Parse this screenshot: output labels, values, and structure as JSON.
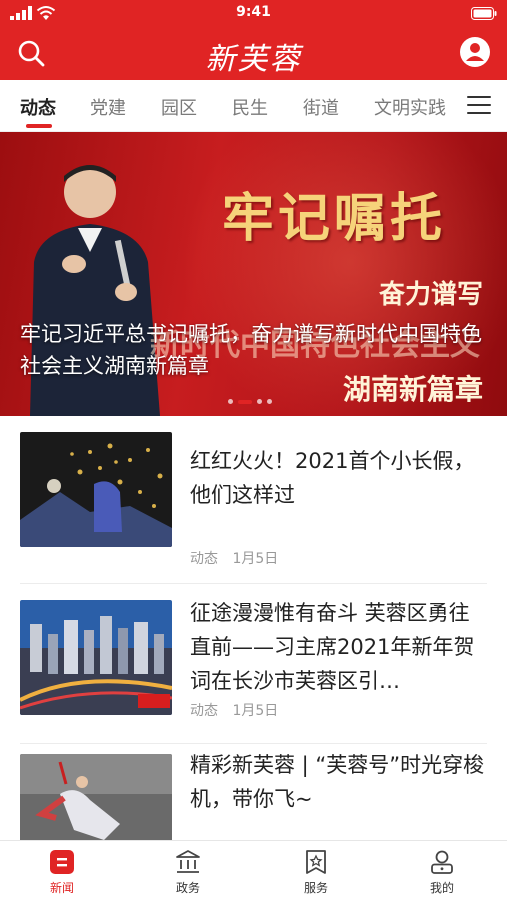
{
  "status_bar": {
    "time": "9:41"
  },
  "header": {
    "logo_text": "新芙蓉",
    "icons": [
      "search-icon",
      "user-avatar-icon"
    ]
  },
  "tabs": [
    {
      "label": "动态",
      "active": true
    },
    {
      "label": "党建"
    },
    {
      "label": "园区"
    },
    {
      "label": "民生"
    },
    {
      "label": "街道"
    },
    {
      "label": "文明实践"
    }
  ],
  "banner": {
    "caption": "牢记习近平总书记嘱托，奋力谱写新时代中国特色社会主义湖南新篇章",
    "art_title": "牢记嘱托",
    "art_line1": "奋力谱写",
    "art_line2": "新时代中国特色社会主义",
    "art_line3": "湖南新篇章",
    "slides": 4,
    "active_slide": 2
  },
  "news": [
    {
      "title": "红红火火！2021首个小长假，他们这样过",
      "category": "动态",
      "date": "1月5日"
    },
    {
      "title": "征途漫漫惟有奋斗 芙蓉区勇往直前——习主席2021年新年贺词在长沙市芙蓉区引…",
      "category": "动态",
      "date": "1月5日"
    },
    {
      "title": "精彩新芙蓉 | “芙蓉号”时光穿梭机，带你飞~",
      "category": "",
      "date": ""
    }
  ],
  "bottom_nav": [
    {
      "label": "新闻",
      "icon": "news-icon",
      "active": true
    },
    {
      "label": "政务",
      "icon": "government-building-icon"
    },
    {
      "label": "服务",
      "icon": "service-bookmark-icon"
    },
    {
      "label": "我的",
      "icon": "profile-icon"
    }
  ],
  "colors": {
    "brand_red": "#e02424",
    "text_dark": "#222222",
    "text_gray": "#999999"
  }
}
